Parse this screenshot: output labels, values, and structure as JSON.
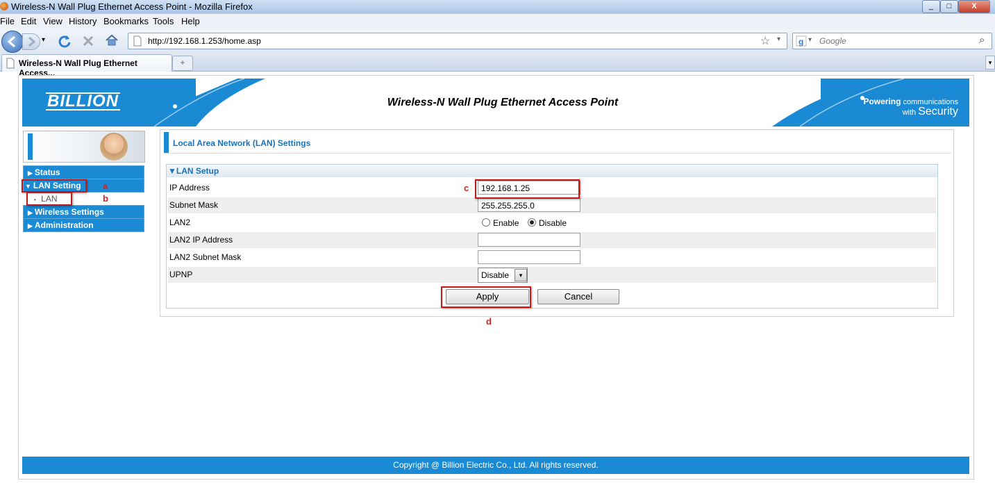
{
  "window": {
    "title": "Wireless-N Wall Plug Ethernet Access Point - Mozilla Firefox",
    "min_label": "_",
    "max_label": "□",
    "close_label": "X"
  },
  "menu": [
    "File",
    "Edit",
    "View",
    "History",
    "Bookmarks",
    "Tools",
    "Help"
  ],
  "nav": {
    "url": "http://192.168.1.253/home.asp",
    "search_placeholder": "Google",
    "star_glyph": "☆",
    "dropdown_glyph": "▾",
    "search_glyph": "⌕"
  },
  "tab": {
    "title": "Wireless-N Wall Plug Ethernet Access...",
    "new_tab_glyph": "+"
  },
  "header": {
    "logo": "BILLION",
    "page_title": "Wireless-N Wall Plug Ethernet Access Point",
    "tag_word1": "Powering",
    "tag_word2": "communications",
    "tag_word3": "with",
    "tag_word4": "Security"
  },
  "sidebar": {
    "items": [
      {
        "label": "Status",
        "arrow": "▶"
      },
      {
        "label": "LAN Setting",
        "arrow": "▼"
      },
      {
        "label": "Wireless Settings",
        "arrow": "▶"
      },
      {
        "label": "Administration",
        "arrow": "▶"
      }
    ],
    "sub_items": [
      {
        "label": "LAN",
        "bullet": "•"
      }
    ]
  },
  "annotations": {
    "a": "a",
    "b": "b",
    "c": "c",
    "d": "d"
  },
  "content": {
    "section_title": "Local Area Network (LAN) Settings",
    "panel_title": "▼LAN Setup",
    "fields": {
      "ip_label": "IP Address",
      "ip_value": "192.168.1.25",
      "subnet_label": "Subnet Mask",
      "subnet_value": "255.255.255.0",
      "lan2_label": "LAN2",
      "lan2_enable": "Enable",
      "lan2_disable": "Disable",
      "lan2_selected": "Disable",
      "lan2_ip_label": "LAN2 IP Address",
      "lan2_ip_value": "",
      "lan2_mask_label": "LAN2 Subnet Mask",
      "lan2_mask_value": "",
      "upnp_label": "UPNP",
      "upnp_value": "Disable"
    },
    "apply_label": "Apply",
    "cancel_label": "Cancel"
  },
  "footer": {
    "text": "Copyright @ Billion Electric Co., Ltd. All rights reserved."
  },
  "colors": {
    "brand_blue": "#1a8ad4",
    "annotation_red": "#c21a1a"
  }
}
